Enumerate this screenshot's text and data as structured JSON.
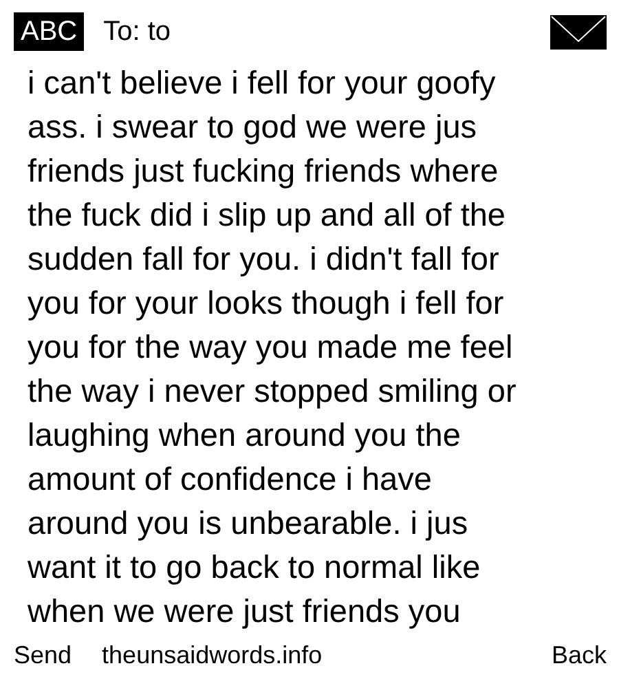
{
  "header": {
    "badge": "ABC",
    "recipient": "To: to"
  },
  "message_lines": [
    "i can't believe i fell for your goofy",
    "ass. i swear to god we were jus",
    "friends just fucking friends where",
    "the fuck did i slip up and all of the",
    "sudden fall for you. i didn't fall for",
    "you for your looks though i fell for",
    "you for the way you made me feel",
    "the way i never stopped smiling or",
    "laughing when around you the",
    "amount of confidence i have",
    "around you is unbearable. i jus",
    "want it to go back to normal like",
    "when we were just friends you"
  ],
  "softkeys": {
    "left": "Send",
    "center": "theunsaidwords.info",
    "right": "Back"
  }
}
